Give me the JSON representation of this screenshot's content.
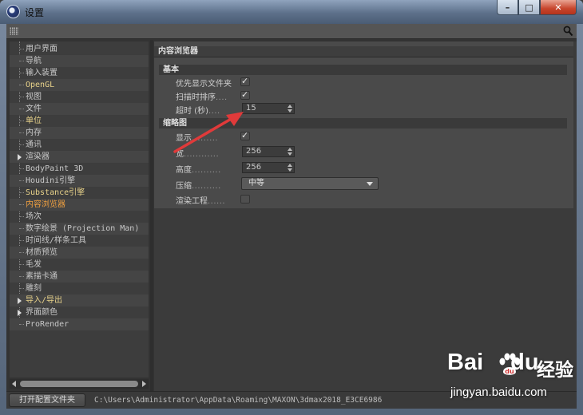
{
  "window": {
    "title": "设置",
    "min_label": "–",
    "max_label": "□",
    "close_label": "✕"
  },
  "tree": {
    "items": [
      {
        "label": "用户界面",
        "style": "normal",
        "arrow": false
      },
      {
        "label": "导航",
        "style": "normal",
        "arrow": false
      },
      {
        "label": "输入装置",
        "style": "normal",
        "arrow": false
      },
      {
        "label": "OpenGL",
        "style": "hl",
        "arrow": false
      },
      {
        "label": "视图",
        "style": "normal",
        "arrow": false
      },
      {
        "label": "文件",
        "style": "normal",
        "arrow": false
      },
      {
        "label": "单位",
        "style": "hl",
        "arrow": false
      },
      {
        "label": "内存",
        "style": "normal",
        "arrow": false
      },
      {
        "label": "通讯",
        "style": "normal",
        "arrow": false
      },
      {
        "label": "渲染器",
        "style": "normal",
        "arrow": true
      },
      {
        "label": "BodyPaint 3D",
        "style": "normal",
        "arrow": false
      },
      {
        "label": "Houdini引擎",
        "style": "normal",
        "arrow": false
      },
      {
        "label": "Substance引擎",
        "style": "hl",
        "arrow": false
      },
      {
        "label": "内容浏览器",
        "style": "active",
        "arrow": false
      },
      {
        "label": "场次",
        "style": "normal",
        "arrow": false
      },
      {
        "label": "数字绘景 (Projection Man)",
        "style": "normal",
        "arrow": false
      },
      {
        "label": "时间线/样条工具",
        "style": "normal",
        "arrow": false
      },
      {
        "label": "材质预览",
        "style": "normal",
        "arrow": false
      },
      {
        "label": "毛发",
        "style": "normal",
        "arrow": false
      },
      {
        "label": "素描卡通",
        "style": "normal",
        "arrow": false
      },
      {
        "label": "雕刻",
        "style": "normal",
        "arrow": false
      },
      {
        "label": "导入/导出",
        "style": "hl",
        "arrow": true
      },
      {
        "label": "界面颜色",
        "style": "normal",
        "arrow": true
      },
      {
        "label": "ProRender",
        "style": "normal",
        "arrow": false
      }
    ]
  },
  "panel": {
    "title": "内容浏览器",
    "basic": {
      "header": "基本",
      "show_folders_first": {
        "label": "优先显示文件夹",
        "checked": true
      },
      "sort_on_scan": {
        "label": "扫描时排序",
        "dots": "....",
        "checked": true
      },
      "timeout": {
        "label": "超时 (秒)",
        "dots": "....",
        "value": "15"
      }
    },
    "thumbnail": {
      "header": "缩略图",
      "show": {
        "label": "显示",
        "dots": ".........",
        "checked": true
      },
      "width": {
        "label": "宽",
        "dots": "............",
        "value": "256"
      },
      "height": {
        "label": "高度",
        "dots": "..........",
        "value": "256"
      },
      "compression": {
        "label": "压缩",
        "dots": "..........",
        "value": "中等"
      },
      "render_project": {
        "label": "渲染工程",
        "dots": "......",
        "checked": false
      }
    }
  },
  "bottom": {
    "open_folder_label": "打开配置文件夹",
    "path": "C:\\Users\\Administrator\\AppData\\Roaming\\MAXON\\3dmax2018_E3CE6986"
  },
  "watermark": {
    "logo": "Bai",
    "logo2": "du",
    "brand": "经验",
    "url": "jingyan.baidu.com"
  },
  "colors": {
    "annotation_arrow": "#e03a3a",
    "active_item": "#f0a040",
    "highlight_item": "#e8d28a"
  }
}
